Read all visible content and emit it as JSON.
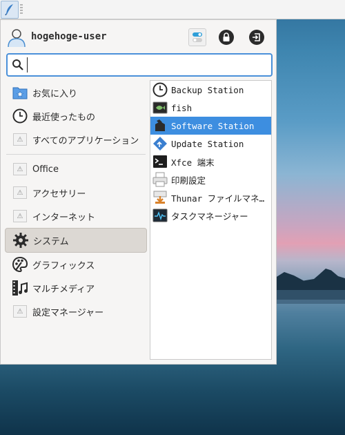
{
  "user": {
    "name": "hogehoge-user"
  },
  "search": {
    "value": "",
    "placeholder": ""
  },
  "categories": [
    {
      "label": "お気に入り",
      "icon": "favorites-icon"
    },
    {
      "label": "最近使ったもの",
      "icon": "clock-icon"
    },
    {
      "label": "すべてのアプリケーション",
      "icon": "missing-icon"
    },
    {
      "label": "Office",
      "icon": "missing-icon"
    },
    {
      "label": "アクセサリー",
      "icon": "missing-icon"
    },
    {
      "label": "インターネット",
      "icon": "missing-icon"
    },
    {
      "label": "システム",
      "icon": "gear-icon",
      "selected": true
    },
    {
      "label": "グラフィックス",
      "icon": "palette-icon"
    },
    {
      "label": "マルチメディア",
      "icon": "film-music-icon"
    },
    {
      "label": "設定マネージャー",
      "icon": "missing-icon"
    }
  ],
  "apps": [
    {
      "label": "Backup Station",
      "icon": "clock-icon"
    },
    {
      "label": "fish",
      "icon": "terminal-fish-icon"
    },
    {
      "label": "Software Station",
      "icon": "package-icon",
      "selected": true
    },
    {
      "label": "Update Station",
      "icon": "update-icon"
    },
    {
      "label": "Xfce 端末",
      "icon": "terminal-icon"
    },
    {
      "label": "印刷設定",
      "icon": "printer-icon"
    },
    {
      "label": "Thunar ファイルマネ…",
      "icon": "file-manager-icon"
    },
    {
      "label": "タスクマネージャー",
      "icon": "task-manager-icon"
    }
  ],
  "colors": {
    "accent": "#3d8ee0",
    "search_border": "#4a90d9"
  }
}
